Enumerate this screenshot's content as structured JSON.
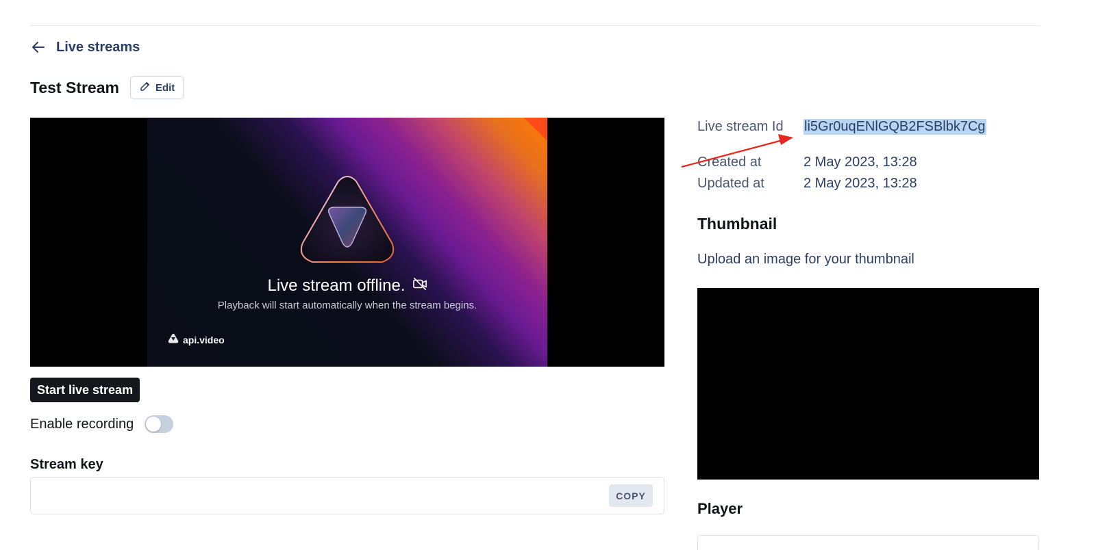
{
  "nav": {
    "back_label": "Live streams"
  },
  "header": {
    "title": "Test Stream",
    "edit_label": "Edit"
  },
  "player": {
    "offline_title": "Live stream offline.",
    "offline_subtitle": "Playback will start automatically when the stream begins.",
    "brand": "api.video"
  },
  "actions": {
    "start_label": "Start live stream"
  },
  "recording": {
    "label": "Enable recording",
    "enabled": false
  },
  "stream_key": {
    "heading": "Stream key",
    "value": "",
    "copy_label": "COPY"
  },
  "details": {
    "id_label": "Live stream Id",
    "id_value": "li5Gr0uqENlGQB2FSBlbk7Cg",
    "created_label": "Created at",
    "created_value": "2 May 2023, 13:28",
    "updated_label": "Updated at",
    "updated_value": "2 May 2023, 13:28"
  },
  "thumbnail": {
    "heading": "Thumbnail",
    "upload_label": "Upload an image for your thumbnail"
  },
  "player_section": {
    "heading": "Player"
  },
  "colors": {
    "primary_dark": "#14171c",
    "link": "#2c3e63",
    "highlight": "#b9d5f5",
    "annotation": "#e8281e"
  }
}
